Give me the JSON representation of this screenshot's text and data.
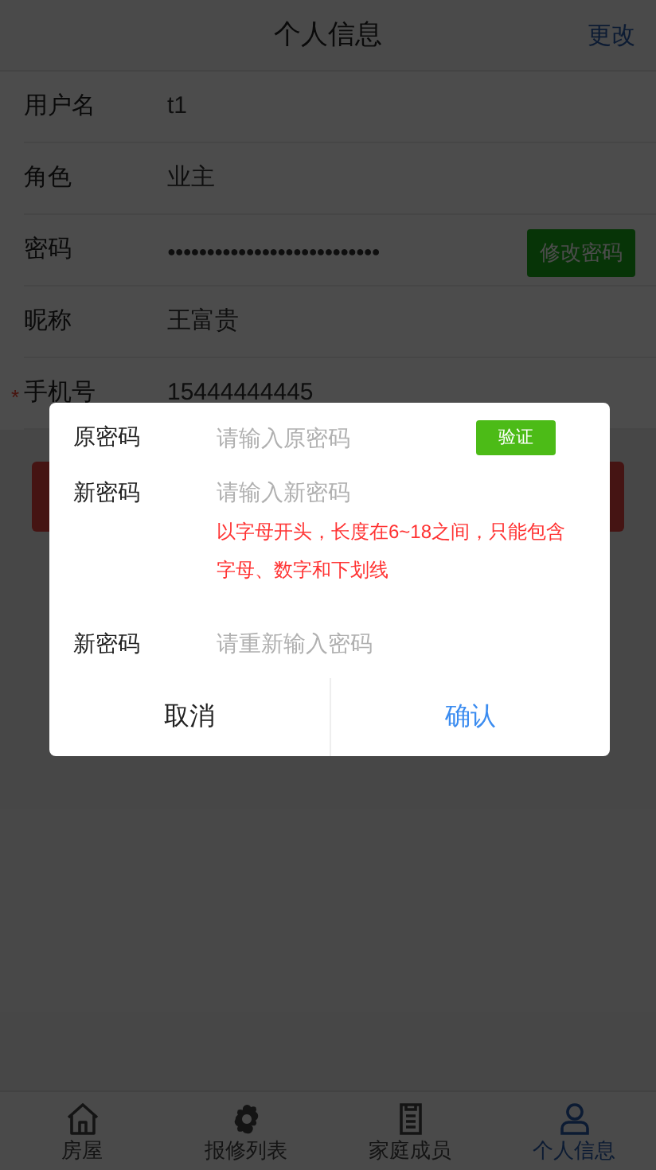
{
  "header": {
    "title": "个人信息",
    "action": "更改"
  },
  "fields": [
    {
      "label": "用户名",
      "value": "t1",
      "kind": "text"
    },
    {
      "label": "角色",
      "value": "业主",
      "kind": "text"
    },
    {
      "label": "密码",
      "value": "●●●●●●●●●●●●●●●●●●●●●●●●●●●",
      "kind": "password",
      "button": "修改密码"
    },
    {
      "label": "昵称",
      "value": "王富贵",
      "kind": "text"
    },
    {
      "label": "手机号",
      "value": "15444444445",
      "kind": "text",
      "required_mark": "*"
    }
  ],
  "dialog": {
    "rows": [
      {
        "label": "原密码",
        "placeholder": "请输入原密码",
        "button": "验证"
      },
      {
        "label": "新密码",
        "placeholder": "请输入新密码",
        "hint": "以字母开头，长度在6~18之间，只能包含字母、数字和下划线"
      },
      {
        "label": "新密码",
        "placeholder": "请重新输入密码"
      }
    ],
    "buttons": [
      {
        "label": "取消",
        "kind": "cancel"
      },
      {
        "label": "确认",
        "kind": "confirm"
      }
    ]
  },
  "tabs": [
    {
      "label": "房屋",
      "selected": false
    },
    {
      "label": "报修列表",
      "selected": false
    },
    {
      "label": "家庭成员",
      "selected": false
    },
    {
      "label": "个人信息",
      "selected": true
    }
  ]
}
